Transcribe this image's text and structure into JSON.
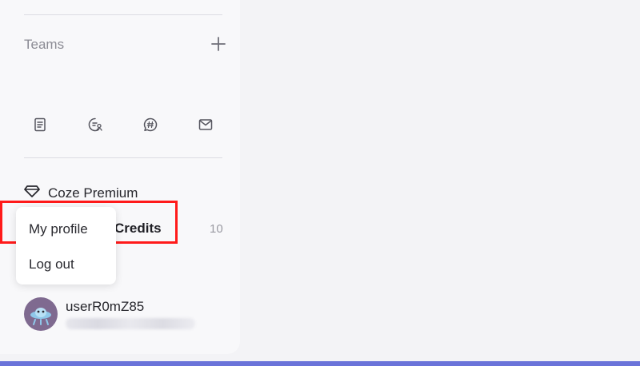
{
  "sidebar": {
    "teams": {
      "label": "Teams",
      "add_icon": "plus-icon"
    },
    "icons": [
      "document-icon",
      "user-chat-icon",
      "hashtag-chat-icon",
      "mail-icon"
    ],
    "premium": {
      "label": "Coze Premium",
      "icon": "diamond-icon"
    },
    "credits": {
      "label": "Credits",
      "count": "10"
    },
    "user": {
      "name": "userR0mZ85",
      "handle": ""
    }
  },
  "menu": {
    "items": [
      "My profile",
      "Log out"
    ]
  },
  "colors": {
    "highlight": "#ff1a1a",
    "bottom_bar": "#6a73d9",
    "avatar": "#7f6a90"
  }
}
